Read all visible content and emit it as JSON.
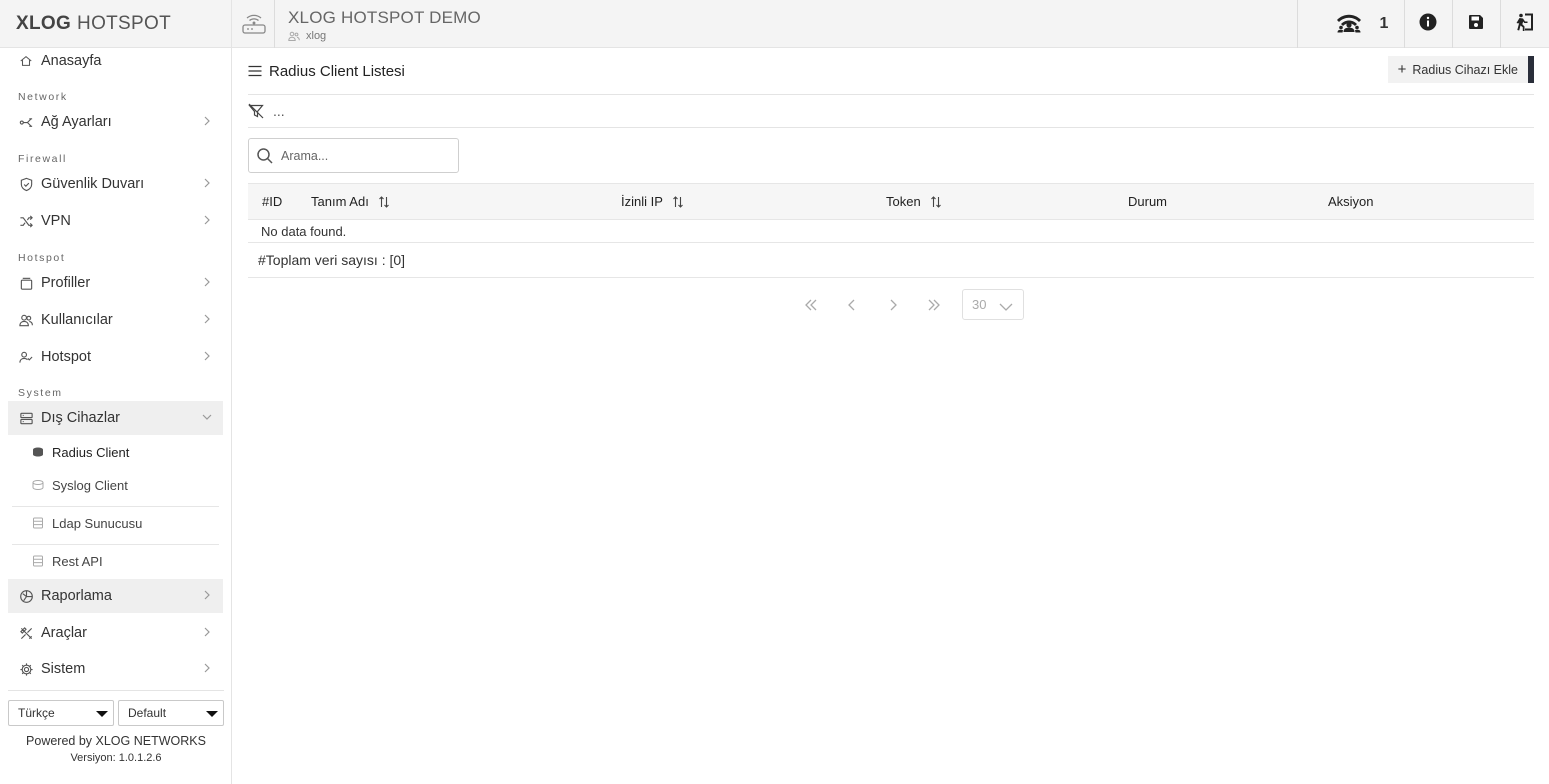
{
  "brand": {
    "bold": "XLOG",
    "rest": "HOTSPOT"
  },
  "topbar": {
    "title": "XLOG HOTSPOT DEMO",
    "subtitle": "xlog",
    "online_count": "1"
  },
  "sidebar": {
    "top_item": "Anasayfa",
    "sections": {
      "network": "Network",
      "firewall": "Firewall",
      "hotspot": "Hotspot",
      "system": "System"
    },
    "items": {
      "ag_ayarlari": "Ağ Ayarları",
      "guvenlik_duvari": "Güvenlik Duvarı",
      "vpn": "VPN",
      "profiller": "Profiller",
      "kullanicilar": "Kullanıcılar",
      "hotspot": "Hotspot",
      "dis_cihazlar": "Dış Cihazlar",
      "raporlama": "Raporlama",
      "araclar": "Araçlar",
      "sistem": "Sistem"
    },
    "sub_items": {
      "radius_client": "Radius Client",
      "syslog_client": "Syslog Client",
      "ldap_sunucusu": "Ldap Sunucusu",
      "rest_api": "Rest API"
    },
    "language_select": "Türkçe",
    "theme_select": "Default",
    "powered_by": "Powered by XLOG NETWORKS",
    "version": "Versiyon: 1.0.1.2.6"
  },
  "main": {
    "title": "Radius Client Listesi",
    "add_button": "Radius Cihazı Ekle",
    "filter_text": "...",
    "search_placeholder": "Arama...",
    "columns": {
      "id": "#ID",
      "tanim_adi": "Tanım Adı",
      "izinli_ip": "İzinli IP",
      "token": "Token",
      "durum": "Durum",
      "aksiyon": "Aksiyon"
    },
    "empty_message": "No data found.",
    "total_label": "#Toplam veri sayısı : [0]",
    "page_size": "30"
  }
}
